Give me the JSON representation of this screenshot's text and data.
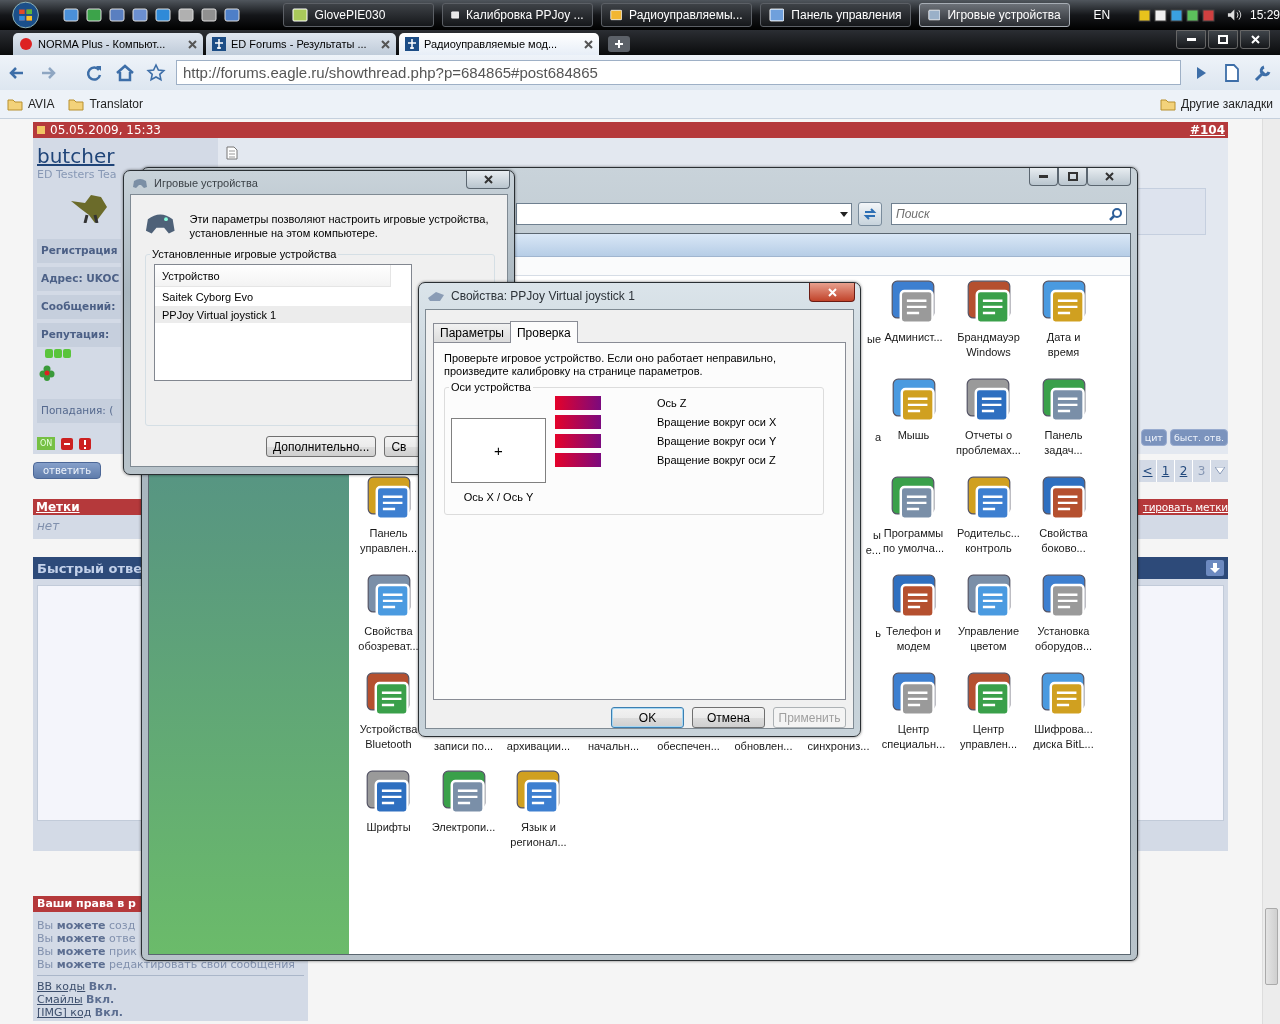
{
  "taskbar": {
    "tasks": [
      {
        "label": "GlovePIE030",
        "selected": false
      },
      {
        "label": "Калибровка PPJoy ...",
        "selected": false
      },
      {
        "label": "Радиоуправляемы...",
        "selected": false
      },
      {
        "label": "Панель управления",
        "selected": false
      },
      {
        "label": "Игровые устройства",
        "selected": true
      }
    ],
    "language": "EN",
    "clock": "15:29"
  },
  "browser": {
    "tabs": [
      {
        "label": "NORMA Plus - Компьют...",
        "selected": false
      },
      {
        "label": "ED Forums - Результаты ...",
        "selected": false
      },
      {
        "label": "Радиоуправляемые мод...",
        "selected": true
      }
    ],
    "url": "http://forums.eagle.ru/showthread.php?p=684865#post684865",
    "bookmarks": [
      "AVIA",
      "Translator"
    ],
    "other_bookmarks": "Другие закладки"
  },
  "forum": {
    "post": {
      "date": "05.05.2009, 15:33",
      "number": "#104",
      "username": "butcher",
      "user_title": "ED Testers Tea",
      "fields": [
        "Регистрация",
        "**Адрес:** UKOC",
        "Сообщений:",
        "Репутация:"
      ],
      "hits": "Попадания: (",
      "status": "ON",
      "reply_button": "ответить",
      "quote_button": "цит",
      "quick_reply_button": "быст. отв."
    },
    "pagination": [
      {
        "label": "<",
        "selected": false
      },
      {
        "label": "1",
        "selected": false
      },
      {
        "label": "2",
        "selected": false
      },
      {
        "label": "3",
        "selected": true
      }
    ],
    "tags": {
      "title": "Метки",
      "value": "нет",
      "edit_link": "тировать метки"
    },
    "quick_reply": {
      "title": "Быстрый отве"
    },
    "rights": {
      "title": "Ваши права в р",
      "lines": [
        "Вы **можете** созд",
        "Вы **можете** отве",
        "Вы **можете** прик",
        "Вы **можете** редактировать свои сообщения"
      ],
      "settings": [
        {
          "label": "BB коды",
          "value": "Вкл."
        },
        {
          "label": "Смайлы",
          "value": "Вкл."
        },
        {
          "label": "[IMG] код",
          "value": "Вкл."
        }
      ]
    }
  },
  "control_panel": {
    "search": {
      "placeholder": "Поиск"
    },
    "rows": [
      [
        {
          "kind": "covered"
        },
        {
          "kind": "covered"
        },
        {
          "kind": "covered"
        },
        {
          "kind": "covered"
        },
        {
          "kind": "covered"
        },
        {
          "kind": "covered"
        },
        {
          "kind": "cut-right",
          "lines": [
            "ые"
          ]
        },
        {
          "kind": "icon",
          "lines": [
            "Админист..."
          ]
        },
        {
          "kind": "icon",
          "lines": [
            "Брандмауэр",
            "Windows"
          ]
        },
        {
          "kind": "icon",
          "lines": [
            "Дата и",
            "время"
          ]
        }
      ],
      [
        {
          "kind": "covered"
        },
        {
          "kind": "covered"
        },
        {
          "kind": "covered"
        },
        {
          "kind": "covered"
        },
        {
          "kind": "covered"
        },
        {
          "kind": "covered"
        },
        {
          "kind": "cut-right",
          "lines": [
            "а"
          ]
        },
        {
          "kind": "icon",
          "lines": [
            "Мышь"
          ]
        },
        {
          "kind": "icon",
          "lines": [
            "Отчеты о",
            "проблемах..."
          ]
        },
        {
          "kind": "icon",
          "lines": [
            "Панель",
            "задач..."
          ]
        }
      ],
      [
        {
          "kind": "icon",
          "lines": [
            "Панель",
            "управлен..."
          ]
        },
        {
          "kind": "covered"
        },
        {
          "kind": "covered"
        },
        {
          "kind": "covered"
        },
        {
          "kind": "covered"
        },
        {
          "kind": "covered"
        },
        {
          "kind": "cut-right",
          "lines": [
            "ы",
            "е..."
          ]
        },
        {
          "kind": "icon",
          "lines": [
            "Программы",
            "по умолча..."
          ]
        },
        {
          "kind": "icon",
          "lines": [
            "Родительс...",
            "контроль"
          ]
        },
        {
          "kind": "icon",
          "lines": [
            "Свойства",
            "боково..."
          ]
        }
      ],
      [
        {
          "kind": "icon",
          "lines": [
            "Свойства",
            "обозреват..."
          ]
        },
        {
          "kind": "covered"
        },
        {
          "kind": "covered"
        },
        {
          "kind": "covered"
        },
        {
          "kind": "covered"
        },
        {
          "kind": "covered"
        },
        {
          "kind": "cut-right",
          "lines": [
            "ь"
          ]
        },
        {
          "kind": "icon",
          "lines": [
            "Телефон и",
            "модем"
          ]
        },
        {
          "kind": "icon",
          "lines": [
            "Управление",
            "цветом"
          ]
        },
        {
          "kind": "icon",
          "lines": [
            "Установка",
            "оборудов..."
          ]
        }
      ],
      [
        {
          "kind": "icon",
          "lines": [
            "Устройства",
            "Bluetooth"
          ]
        },
        {
          "kind": "cut-bottom",
          "lines": [
            "записи по..."
          ]
        },
        {
          "kind": "cut-bottom",
          "lines": [
            "архивации..."
          ]
        },
        {
          "kind": "cut-bottom",
          "lines": [
            "начальн..."
          ]
        },
        {
          "kind": "cut-bottom",
          "lines": [
            "обеспечен..."
          ]
        },
        {
          "kind": "cut-bottom",
          "lines": [
            "обновлен..."
          ]
        },
        {
          "kind": "cut-bottom",
          "lines": [
            "синхрониз..."
          ]
        },
        {
          "kind": "icon",
          "lines": [
            "Центр",
            "специальн..."
          ]
        },
        {
          "kind": "icon",
          "lines": [
            "Центр",
            "управлен..."
          ]
        },
        {
          "kind": "icon",
          "lines": [
            "Шифрова...",
            "диска BitL..."
          ]
        }
      ],
      [
        {
          "kind": "icon",
          "lines": [
            "Шрифты"
          ]
        },
        {
          "kind": "icon",
          "lines": [
            "Электропи..."
          ]
        },
        {
          "kind": "icon",
          "lines": [
            "Язык и",
            "регионал..."
          ]
        }
      ]
    ]
  },
  "game_devices": {
    "title": "Игровые устройства",
    "description": "Эти параметры позволяют настроить игровые устройства, установленные на этом компьютере.",
    "group": "Установленные игровые устройства",
    "column": "Устройство",
    "devices": [
      {
        "name": "Saitek Cyborg Evo",
        "selected": false
      },
      {
        "name": "PPJoy Virtual joystick 1",
        "selected": true
      }
    ],
    "buttons": [
      "Дополнительно...",
      "Св"
    ]
  },
  "properties": {
    "title": "Свойства: PPJoy Virtual joystick 1",
    "tabs": [
      {
        "label": "Параметры",
        "selected": false
      },
      {
        "label": "Проверка",
        "selected": true
      }
    ],
    "instructions": "Проверьте игровое устройство. Если оно работает неправильно, произведите калибровку на странице параметров.",
    "group": "Оси устройства",
    "xy_label": "Ось X / Ось Y",
    "xy_marker": "+",
    "axes": [
      {
        "label": "Ось Z",
        "level": 1
      },
      {
        "label": "Вращение вокруг оси X",
        "level": 1
      },
      {
        "label": "Вращение вокруг оси Y",
        "level": 1
      },
      {
        "label": "Вращение вокруг оси Z",
        "level": 1
      }
    ],
    "buttons": [
      {
        "label": "OK",
        "default": true,
        "disabled": false
      },
      {
        "label": "Отмена",
        "default": false,
        "disabled": false
      },
      {
        "label": "Применить",
        "default": false,
        "disabled": true
      }
    ]
  }
}
